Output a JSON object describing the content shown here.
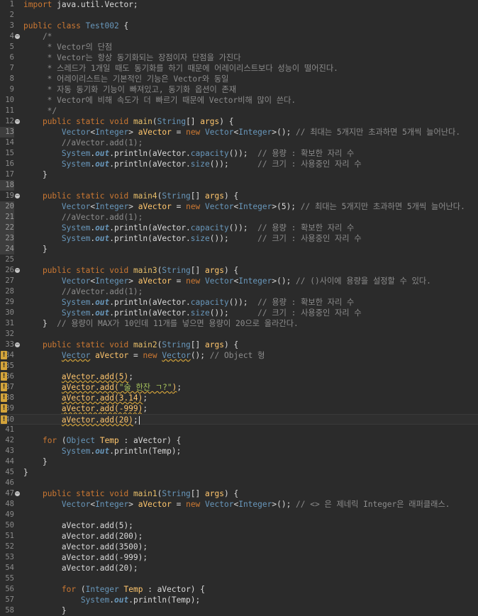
{
  "editor": {
    "lines": [
      {
        "n": "1",
        "segs": [
          [
            "kw",
            "import"
          ],
          [
            "pl",
            " java.util.Vector;"
          ]
        ]
      },
      {
        "n": "2",
        "segs": []
      },
      {
        "n": "3",
        "segs": [
          [
            "kw",
            "public class "
          ],
          [
            "ty",
            "Test002"
          ],
          [
            "pl",
            " {"
          ]
        ]
      },
      {
        "n": "4",
        "fold": true,
        "segs": [
          [
            "cm",
            "    /*"
          ]
        ]
      },
      {
        "n": "5",
        "segs": [
          [
            "cm",
            "     * Vector의 단점"
          ]
        ]
      },
      {
        "n": "6",
        "segs": [
          [
            "cm",
            "     * Vector는 항상 동기화되는 장점이자 단점을 가진다"
          ]
        ]
      },
      {
        "n": "7",
        "segs": [
          [
            "cm",
            "     * 스레드가 1개일 때도 동기화를 하기 때문에 어레이리스트보다 성능이 떨어진다."
          ]
        ]
      },
      {
        "n": "8",
        "segs": [
          [
            "cm",
            "     * 어레이리스트는 기본적인 기능은 Vector와 동일"
          ]
        ]
      },
      {
        "n": "9",
        "segs": [
          [
            "cm",
            "     * 자동 동기화 기능이 빠져있고, 동기화 옵션이 존재"
          ]
        ]
      },
      {
        "n": "10",
        "segs": [
          [
            "cm",
            "     * Vector에 비해 속도가 더 빠르기 때문에 Vector비해 많이 쓴다."
          ]
        ]
      },
      {
        "n": "11",
        "segs": [
          [
            "cm",
            "     */"
          ]
        ]
      },
      {
        "n": "12",
        "fold": true,
        "segs": [
          [
            "pl",
            "    "
          ],
          [
            "kw",
            "public static void "
          ],
          [
            "fn",
            "main"
          ],
          [
            "pl",
            "("
          ],
          [
            "ty",
            "String"
          ],
          [
            "pl",
            "[] "
          ],
          [
            "var",
            "args"
          ],
          [
            "pl",
            ") {"
          ]
        ]
      },
      {
        "n": "13",
        "hl": true,
        "segs": [
          [
            "pl",
            "        "
          ],
          [
            "ty",
            "Vector"
          ],
          [
            "pl",
            "<"
          ],
          [
            "ty",
            "Integer"
          ],
          [
            "pl",
            "> "
          ],
          [
            "var",
            "aVector"
          ],
          [
            "pl",
            " = "
          ],
          [
            "kw",
            "new "
          ],
          [
            "ty",
            "Vector"
          ],
          [
            "pl",
            "<"
          ],
          [
            "ty",
            "Integer"
          ],
          [
            "pl",
            ">(); "
          ],
          [
            "cm",
            "// 최대는 5개지만 초과하면 5개씩 늘어난다."
          ]
        ]
      },
      {
        "n": "14",
        "segs": [
          [
            "cm",
            "        //aVector.add(1);"
          ]
        ]
      },
      {
        "n": "15",
        "segs": [
          [
            "pl",
            "        "
          ],
          [
            "ty",
            "System"
          ],
          [
            "pl",
            "."
          ],
          [
            "fd",
            "out"
          ],
          [
            "pl",
            ".println(aVector."
          ],
          [
            "ty",
            "capacity"
          ],
          [
            "pl",
            "());  "
          ],
          [
            "cm",
            "// 용량 : 확보한 자리 수"
          ]
        ]
      },
      {
        "n": "16",
        "segs": [
          [
            "pl",
            "        "
          ],
          [
            "ty",
            "System"
          ],
          [
            "pl",
            "."
          ],
          [
            "fd",
            "out"
          ],
          [
            "pl",
            ".println(aVector."
          ],
          [
            "ty",
            "size"
          ],
          [
            "pl",
            "());      "
          ],
          [
            "cm",
            "// 크기 : 사용중인 자리 수"
          ]
        ]
      },
      {
        "n": "17",
        "segs": [
          [
            "pl",
            "    }"
          ]
        ]
      },
      {
        "n": "18",
        "hl": true,
        "segs": []
      },
      {
        "n": "19",
        "fold": true,
        "segs": [
          [
            "pl",
            "    "
          ],
          [
            "kw",
            "public static void "
          ],
          [
            "fn",
            "main4"
          ],
          [
            "pl",
            "("
          ],
          [
            "ty",
            "String"
          ],
          [
            "pl",
            "[] "
          ],
          [
            "var",
            "args"
          ],
          [
            "pl",
            ") {"
          ]
        ]
      },
      {
        "n": "20",
        "hl": true,
        "segs": [
          [
            "pl",
            "        "
          ],
          [
            "ty",
            "Vector"
          ],
          [
            "pl",
            "<"
          ],
          [
            "ty",
            "Integer"
          ],
          [
            "pl",
            "> "
          ],
          [
            "var",
            "aVector"
          ],
          [
            "pl",
            " = "
          ],
          [
            "kw",
            "new "
          ],
          [
            "ty",
            "Vector"
          ],
          [
            "pl",
            "<"
          ],
          [
            "ty",
            "Integer"
          ],
          [
            "pl",
            ">(5); "
          ],
          [
            "cm",
            "// 최대는 5개지만 초과하면 5개씩 늘어난다."
          ]
        ]
      },
      {
        "n": "21",
        "hl": true,
        "segs": [
          [
            "cm",
            "        //aVector.add(1);"
          ]
        ]
      },
      {
        "n": "22",
        "hl": true,
        "segs": [
          [
            "pl",
            "        "
          ],
          [
            "ty",
            "System"
          ],
          [
            "pl",
            "."
          ],
          [
            "fd",
            "out"
          ],
          [
            "pl",
            ".println(aVector."
          ],
          [
            "ty",
            "capacity"
          ],
          [
            "pl",
            "());  "
          ],
          [
            "cm",
            "// 용량 : 확보한 자리 수"
          ]
        ]
      },
      {
        "n": "23",
        "hl": true,
        "segs": [
          [
            "pl",
            "        "
          ],
          [
            "ty",
            "System"
          ],
          [
            "pl",
            "."
          ],
          [
            "fd",
            "out"
          ],
          [
            "pl",
            ".println(aVector."
          ],
          [
            "ty",
            "size"
          ],
          [
            "pl",
            "());      "
          ],
          [
            "cm",
            "// 크기 : 사용중인 자리 수"
          ]
        ]
      },
      {
        "n": "24",
        "hl": true,
        "segs": [
          [
            "pl",
            "    }"
          ]
        ]
      },
      {
        "n": "25",
        "segs": []
      },
      {
        "n": "26",
        "fold": true,
        "segs": [
          [
            "pl",
            "    "
          ],
          [
            "kw",
            "public static void "
          ],
          [
            "fn",
            "main3"
          ],
          [
            "pl",
            "("
          ],
          [
            "ty",
            "String"
          ],
          [
            "pl",
            "[] "
          ],
          [
            "var",
            "args"
          ],
          [
            "pl",
            ") {"
          ]
        ]
      },
      {
        "n": "27",
        "segs": [
          [
            "pl",
            "        "
          ],
          [
            "ty",
            "Vector"
          ],
          [
            "pl",
            "<"
          ],
          [
            "ty",
            "Integer"
          ],
          [
            "pl",
            "> "
          ],
          [
            "var",
            "aVector"
          ],
          [
            "pl",
            " = "
          ],
          [
            "kw",
            "new "
          ],
          [
            "ty",
            "Vector"
          ],
          [
            "pl",
            "<"
          ],
          [
            "ty",
            "Integer"
          ],
          [
            "pl",
            ">(); "
          ],
          [
            "cm",
            "// ()사이에 용량을 설정할 수 있다."
          ]
        ]
      },
      {
        "n": "28",
        "segs": [
          [
            "cm",
            "        //aVector.add(1);"
          ]
        ]
      },
      {
        "n": "29",
        "segs": [
          [
            "pl",
            "        "
          ],
          [
            "ty",
            "System"
          ],
          [
            "pl",
            "."
          ],
          [
            "fd",
            "out"
          ],
          [
            "pl",
            ".println(aVector."
          ],
          [
            "ty",
            "capacity"
          ],
          [
            "pl",
            "());  "
          ],
          [
            "cm",
            "// 용량 : 확보한 자리 수"
          ]
        ]
      },
      {
        "n": "30",
        "segs": [
          [
            "pl",
            "        "
          ],
          [
            "ty",
            "System"
          ],
          [
            "pl",
            "."
          ],
          [
            "fd",
            "out"
          ],
          [
            "pl",
            ".println(aVector."
          ],
          [
            "ty",
            "size"
          ],
          [
            "pl",
            "());      "
          ],
          [
            "cm",
            "// 크기 : 사용중인 자리 수"
          ]
        ]
      },
      {
        "n": "31",
        "segs": [
          [
            "pl",
            "    }  "
          ],
          [
            "cm",
            "// 용량이 MAX가 10인데 11개를 넣으면 용량이 20으로 올라간다."
          ]
        ]
      },
      {
        "n": "32",
        "segs": []
      },
      {
        "n": "33",
        "fold": true,
        "segs": [
          [
            "pl",
            "    "
          ],
          [
            "kw",
            "public static void "
          ],
          [
            "fn",
            "main2"
          ],
          [
            "pl",
            "("
          ],
          [
            "ty",
            "String"
          ],
          [
            "pl",
            "[] "
          ],
          [
            "var",
            "args"
          ],
          [
            "pl",
            ") {"
          ]
        ]
      },
      {
        "n": "34",
        "warn": true,
        "segs": [
          [
            "pl",
            "        "
          ],
          [
            "ty wv",
            "Vector"
          ],
          [
            "pl",
            " "
          ],
          [
            "var",
            "aVector"
          ],
          [
            "pl",
            " = "
          ],
          [
            "kw",
            "new "
          ],
          [
            "ty wv",
            "Vector"
          ],
          [
            "pl",
            "(); "
          ],
          [
            "cm",
            "// Object 형"
          ]
        ]
      },
      {
        "n": "35",
        "warn": true,
        "segs": []
      },
      {
        "n": "36",
        "warn": true,
        "segs": [
          [
            "pl",
            "        "
          ],
          [
            "var wv",
            "aVector.add(5)"
          ],
          [
            "pl",
            ";"
          ]
        ]
      },
      {
        "n": "37",
        "warn": true,
        "segs": [
          [
            "pl",
            "        "
          ],
          [
            "var wv",
            "aVector.add("
          ],
          [
            "str wv",
            "\"술 한잔 ㄱ?\""
          ],
          [
            "var wv",
            ")"
          ],
          [
            "pl",
            ";"
          ]
        ]
      },
      {
        "n": "38",
        "warn": true,
        "segs": [
          [
            "pl",
            "        "
          ],
          [
            "var wv",
            "aVector.add(3.14)"
          ],
          [
            "pl",
            ";"
          ]
        ]
      },
      {
        "n": "39",
        "warn": true,
        "segs": [
          [
            "pl",
            "        "
          ],
          [
            "var wv",
            "aVector.add(-999)"
          ],
          [
            "pl",
            ";"
          ]
        ]
      },
      {
        "n": "40",
        "warn": true,
        "cur": true,
        "segs": [
          [
            "pl",
            "        "
          ],
          [
            "var wv",
            "aVector.add(20)"
          ],
          [
            "pl",
            ";"
          ]
        ]
      },
      {
        "n": "41",
        "segs": []
      },
      {
        "n": "42",
        "segs": [
          [
            "pl",
            "    "
          ],
          [
            "kw",
            "for "
          ],
          [
            "pl",
            "("
          ],
          [
            "ty",
            "Object"
          ],
          [
            "pl",
            " "
          ],
          [
            "var",
            "Temp"
          ],
          [
            "pl",
            " : aVector) {"
          ]
        ]
      },
      {
        "n": "43",
        "segs": [
          [
            "pl",
            "        "
          ],
          [
            "ty",
            "System"
          ],
          [
            "pl",
            "."
          ],
          [
            "fd",
            "out"
          ],
          [
            "pl",
            ".println(Temp);"
          ]
        ]
      },
      {
        "n": "44",
        "segs": [
          [
            "pl",
            "    }"
          ]
        ]
      },
      {
        "n": "45",
        "segs": [
          [
            "pl",
            "}"
          ]
        ]
      },
      {
        "n": "46",
        "segs": []
      },
      {
        "n": "47",
        "fold": true,
        "segs": [
          [
            "pl",
            "    "
          ],
          [
            "kw",
            "public static void "
          ],
          [
            "fn",
            "main1"
          ],
          [
            "pl",
            "("
          ],
          [
            "ty",
            "String"
          ],
          [
            "pl",
            "[] "
          ],
          [
            "var",
            "args"
          ],
          [
            "pl",
            ") {"
          ]
        ]
      },
      {
        "n": "48",
        "segs": [
          [
            "pl",
            "        "
          ],
          [
            "ty",
            "Vector"
          ],
          [
            "pl",
            "<"
          ],
          [
            "ty",
            "Integer"
          ],
          [
            "pl",
            "> "
          ],
          [
            "var",
            "aVector"
          ],
          [
            "pl",
            " = "
          ],
          [
            "kw",
            "new "
          ],
          [
            "ty",
            "Vector"
          ],
          [
            "pl",
            "<"
          ],
          [
            "ty",
            "Integer"
          ],
          [
            "pl",
            ">(); "
          ],
          [
            "cm",
            "// <> 은 제네릭 Integer은 래퍼클래스."
          ]
        ]
      },
      {
        "n": "49",
        "segs": []
      },
      {
        "n": "50",
        "segs": [
          [
            "pl",
            "        aVector.add(5);"
          ]
        ]
      },
      {
        "n": "51",
        "segs": [
          [
            "pl",
            "        aVector.add(200);"
          ]
        ]
      },
      {
        "n": "52",
        "segs": [
          [
            "pl",
            "        aVector.add(3500);"
          ]
        ]
      },
      {
        "n": "53",
        "segs": [
          [
            "pl",
            "        aVector.add(-999);"
          ]
        ]
      },
      {
        "n": "54",
        "segs": [
          [
            "pl",
            "        aVector.add(20);"
          ]
        ]
      },
      {
        "n": "55",
        "segs": []
      },
      {
        "n": "56",
        "segs": [
          [
            "pl",
            "        "
          ],
          [
            "kw",
            "for "
          ],
          [
            "pl",
            "("
          ],
          [
            "ty",
            "Integer"
          ],
          [
            "pl",
            " "
          ],
          [
            "var",
            "Temp"
          ],
          [
            "pl",
            " : aVector) {"
          ]
        ]
      },
      {
        "n": "57",
        "segs": [
          [
            "pl",
            "            "
          ],
          [
            "ty",
            "System"
          ],
          [
            "pl",
            "."
          ],
          [
            "fd",
            "out"
          ],
          [
            "pl",
            ".println(Temp);"
          ]
        ]
      },
      {
        "n": "58",
        "segs": [
          [
            "pl",
            "        }"
          ]
        ]
      }
    ],
    "colors": {
      "background": "#2b2b2b",
      "keyword": "#cc7832",
      "type": "#6897bb",
      "method": "#e8bf6a",
      "comment": "#8c8c8c",
      "string": "#a5c25c",
      "warning": "#d4a43a"
    },
    "icons": {
      "fold": "collapse-circle-icon",
      "warning": "warning-marker-icon"
    }
  }
}
